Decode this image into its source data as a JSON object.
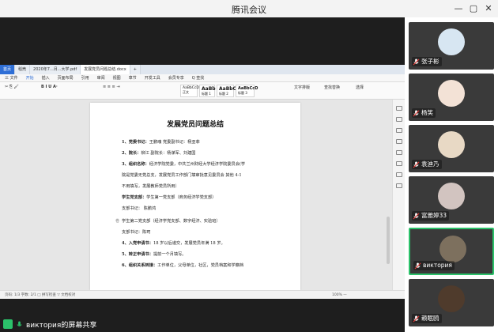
{
  "window": {
    "title": "腾讯会议",
    "minimize": "—",
    "maximize": "▢",
    "close": "✕"
  },
  "wps": {
    "tabs": [
      "首页",
      "稻壳",
      "2020年7...月...大学.pdf",
      "发展党员问题总结.docx",
      "+"
    ],
    "menu": [
      "三 文件",
      "开始",
      "插入",
      "页面布局",
      "引用",
      "审阅",
      "视图",
      "章节",
      "开发工具",
      "会员专享",
      "Q 查找"
    ],
    "menu_active_index": 1,
    "styles": [
      "AaBbCcDd",
      "AaBb",
      "AaBbC",
      "AaBbCcD"
    ],
    "style_names": [
      "正文",
      "标题 1",
      "标题 2",
      "标题 3"
    ],
    "ribbon_right": [
      "文字排版",
      "查找替换",
      "选择"
    ],
    "document": {
      "title": "发展党员问题总结",
      "lines": [
        {
          "label": "1、党委书记：",
          "text": "王鹏魂  党委副书记：杨亚菲"
        },
        {
          "label": "2、院长：",
          "text": "柳江  副院长：杨谋军、刘建国"
        },
        {
          "label": "3、组织名称：",
          "text": "经济学院党委，中共兰州财经大学经济学院委员会(学"
        },
        {
          "label": "",
          "text": "院是党委无党总支，发展党员工作部门填审批意见委员会  其他 4-1"
        },
        {
          "label": "",
          "text": "不用填写，发展教师党员所用）"
        },
        {
          "label": "学生党支部：",
          "text": "学生第一党支部（商务经济学党支部）"
        },
        {
          "label": "",
          "text": "支部书记：   陈鹏鸿"
        },
        {
          "label": "",
          "text": "学生第二党支部（经济学党支部、数字经济、实验班）"
        },
        {
          "label": "",
          "text": "支部书记：陈珂"
        },
        {
          "label": "4、入党申请书：",
          "text": "18 岁以后递交，发展党员年满 18 岁。"
        },
        {
          "label": "5、转正申请书：",
          "text": "提前一个月填写。"
        },
        {
          "label": "6、组织关系转接：",
          "text": "工作单位，父母单位，社区，党员档案和学籍档"
        }
      ],
      "margin_mark": "卷"
    },
    "status": {
      "left": "页码: 1/3    字数: 2/1 □ 拼写检查 ▽ 文档校对",
      "zoom": "100% —"
    }
  },
  "participants": [
    {
      "name": "张子彬",
      "avatar_color": "#d7e6f2"
    },
    {
      "name": "杨笑",
      "avatar_color": "#f3e2d6"
    },
    {
      "name": "袁迪乃",
      "avatar_color": "#e8d9c5"
    },
    {
      "name": "富雅婷33",
      "avatar_color": "#d2c4c0"
    },
    {
      "name": "виктория",
      "avatar_color": "#7d705e"
    },
    {
      "name": "赖眠鸥",
      "avatar_color": "#4f3b2c"
    }
  ],
  "share": {
    "label": "виктория的屏幕共享"
  }
}
